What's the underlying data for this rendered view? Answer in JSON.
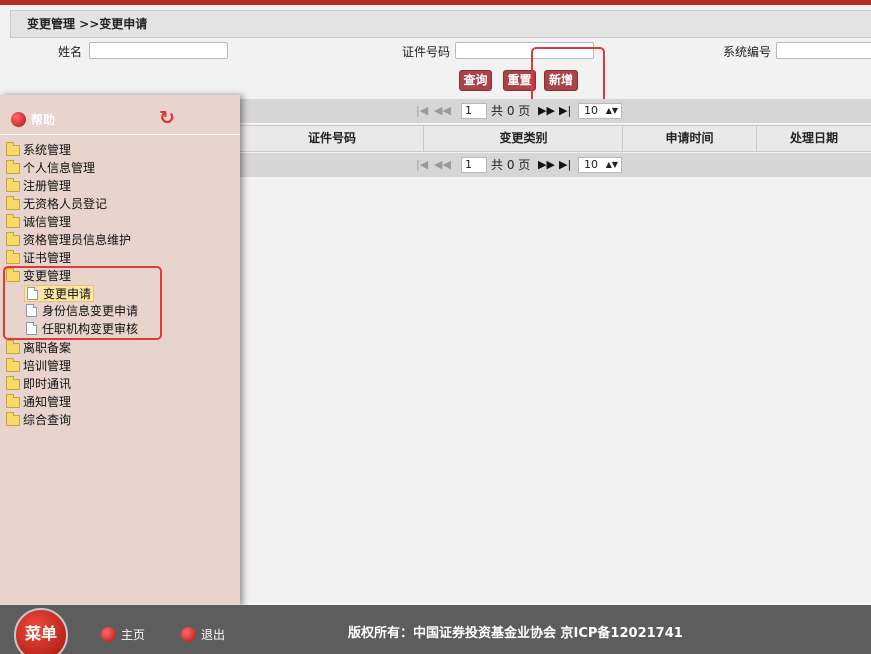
{
  "breadcrumb": "变更管理 >>变更申请",
  "search": {
    "name_label": "姓名",
    "name_value": "",
    "id_label": "证件号码",
    "id_value": "",
    "sys_label": "系统编号",
    "sys_value": ""
  },
  "buttons": {
    "query": "查询",
    "reset": "重置",
    "add": "新增"
  },
  "pager": {
    "page": "1",
    "total": "共 0 页",
    "page_size": "10"
  },
  "table": {
    "columns": [
      "证件号码",
      "变更类别",
      "申请时间",
      "处理日期"
    ]
  },
  "sidebar": {
    "help": "帮助",
    "items": [
      {
        "label": "系统管理"
      },
      {
        "label": "个人信息管理"
      },
      {
        "label": "注册管理"
      },
      {
        "label": "无资格人员登记"
      },
      {
        "label": "诚信管理"
      },
      {
        "label": "资格管理员信息维护"
      },
      {
        "label": "证书管理"
      },
      {
        "label": "变更管理",
        "open": true
      },
      {
        "label": "离职备案"
      },
      {
        "label": "培训管理"
      },
      {
        "label": "即时通讯"
      },
      {
        "label": "通知管理"
      },
      {
        "label": "综合查询"
      }
    ],
    "children": [
      {
        "label": "变更申请",
        "selected": true
      },
      {
        "label": "身份信息变更申请"
      },
      {
        "label": "任职机构变更审核"
      }
    ]
  },
  "footer": {
    "menu": "菜单",
    "home": "主页",
    "logout": "退出",
    "copyright": "版权所有：中国证券投资基金业协会 京ICP备12021741"
  },
  "colors": {
    "accent": "#b52b22",
    "button": "#a8434a",
    "highlight": "#e0393a",
    "sidebar_bg": "#e8d3cd",
    "footer_bg": "#5d5d5d"
  }
}
